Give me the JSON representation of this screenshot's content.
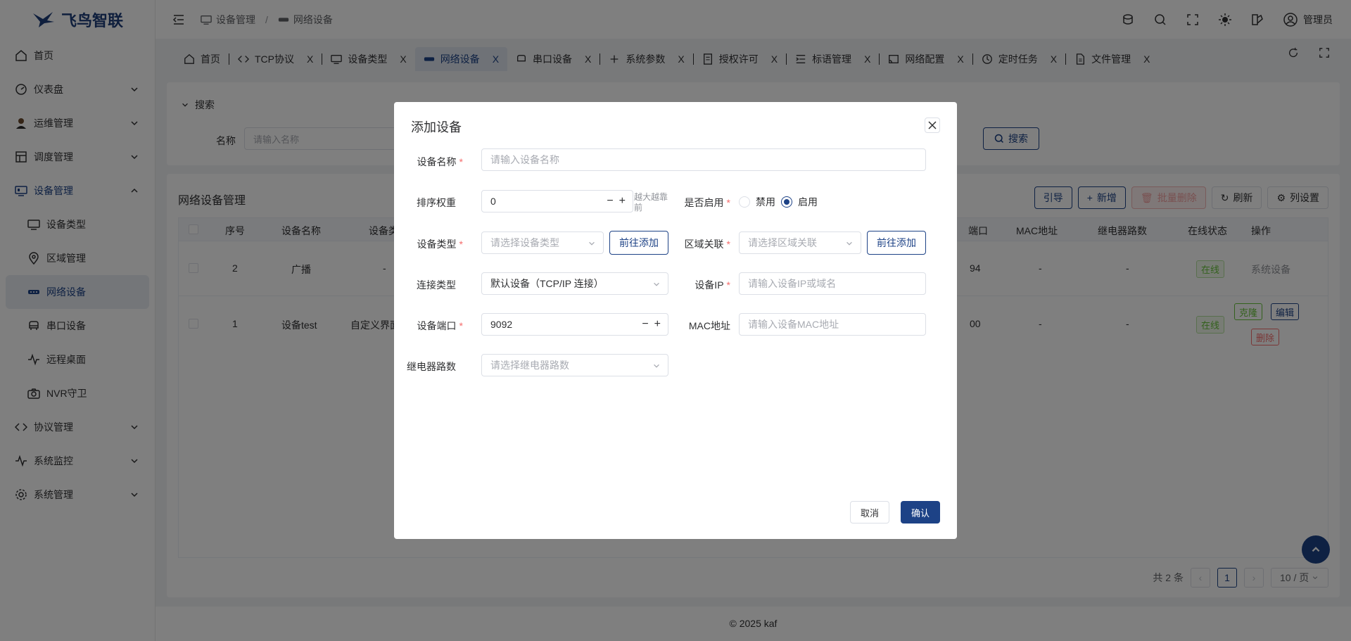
{
  "app": {
    "brand": "飞鸟智联",
    "user": "管理员",
    "footer": "© 2025 kaf"
  },
  "breadcrumb": [
    "设备管理",
    "网络设备"
  ],
  "sidebar": {
    "items": [
      {
        "label": "首页",
        "icon": "home-icon"
      },
      {
        "label": "仪表盘",
        "icon": "dashboard-icon"
      },
      {
        "label": "运维管理",
        "icon": "operator-avatar-icon"
      },
      {
        "label": "调度管理",
        "icon": "schedule-icon"
      },
      {
        "label": "设备管理",
        "icon": "device-icon"
      },
      {
        "label": "设备类型",
        "icon": "device-type-icon"
      },
      {
        "label": "区域管理",
        "icon": "location-icon"
      },
      {
        "label": "网络设备",
        "icon": "network-icon"
      },
      {
        "label": "串口设备",
        "icon": "serial-icon"
      },
      {
        "label": "远程桌面",
        "icon": "pulse-icon"
      },
      {
        "label": "NVR守卫",
        "icon": "camera-icon"
      },
      {
        "label": "协议管理",
        "icon": "code-icon"
      },
      {
        "label": "系统监控",
        "icon": "pulse-icon"
      },
      {
        "label": "系统管理",
        "icon": "gear-icon"
      }
    ]
  },
  "tabs": [
    {
      "label": "首页"
    },
    {
      "label": "TCP协议"
    },
    {
      "label": "设备类型"
    },
    {
      "label": "网络设备"
    },
    {
      "label": "串口设备"
    },
    {
      "label": "系统参数"
    },
    {
      "label": "授权许可"
    },
    {
      "label": "标语管理"
    },
    {
      "label": "网络配置"
    },
    {
      "label": "定时任务"
    },
    {
      "label": "文件管理"
    }
  ],
  "tab_close": "X",
  "search": {
    "title": "搜索",
    "name_label": "名称",
    "name_placeholder": "请输入名称",
    "button": "搜索"
  },
  "table": {
    "title": "网络设备管理",
    "toolbar": {
      "guide": "引导",
      "add": "新增",
      "batch_delete": "批量删除",
      "refresh": "刷新",
      "columns": "列设置"
    },
    "headers": {
      "index": "序号",
      "name": "设备名称",
      "type": "设备类",
      "port": "端口",
      "mac": "MAC地址",
      "relay": "继电器路数",
      "status": "在线状态",
      "ops": "操作"
    },
    "rows": [
      {
        "index": "2",
        "name": "广播",
        "type": "-",
        "port": "94",
        "mac": "-",
        "relay": "-",
        "status": "在线",
        "ops_text": "系统设备"
      },
      {
        "index": "1",
        "name": "设备test",
        "type": "自定义界面",
        "port": "00",
        "mac": "-",
        "relay": "-",
        "status": "在线",
        "clone": "克隆",
        "edit": "编辑",
        "delete": "删除"
      }
    ],
    "pagination": {
      "total": "共 2 条",
      "current": "1",
      "size": "10 / 页"
    }
  },
  "dialog": {
    "title": "添加设备",
    "fields": {
      "device_name": {
        "label": "设备名称",
        "placeholder": "请输入设备名称"
      },
      "sort_weight": {
        "label": "排序权重",
        "value": "0",
        "hint": "越大越靠前"
      },
      "enabled": {
        "label": "是否启用",
        "options": [
          "禁用",
          "启用"
        ],
        "selected": "启用"
      },
      "device_type": {
        "label": "设备类型",
        "placeholder": "请选择设备类型",
        "go_add": "前往添加"
      },
      "area": {
        "label": "区域关联",
        "placeholder": "请选择区域关联",
        "go_add": "前往添加"
      },
      "conn_type": {
        "label": "连接类型",
        "value": "默认设备（TCP/IP 连接）"
      },
      "device_ip": {
        "label": "设备IP",
        "placeholder": "请输入设备IP或域名"
      },
      "device_port": {
        "label": "设备端口",
        "value": "9092"
      },
      "mac": {
        "label": "MAC地址",
        "placeholder": "请输入设备MAC地址"
      },
      "relay": {
        "label": "继电器路数",
        "placeholder": "请选择继电器路数"
      }
    },
    "cancel": "取消",
    "confirm": "确认"
  },
  "colors": {
    "primary": "#1d4286",
    "danger": "#f56c6c",
    "success": "#67c23a"
  }
}
